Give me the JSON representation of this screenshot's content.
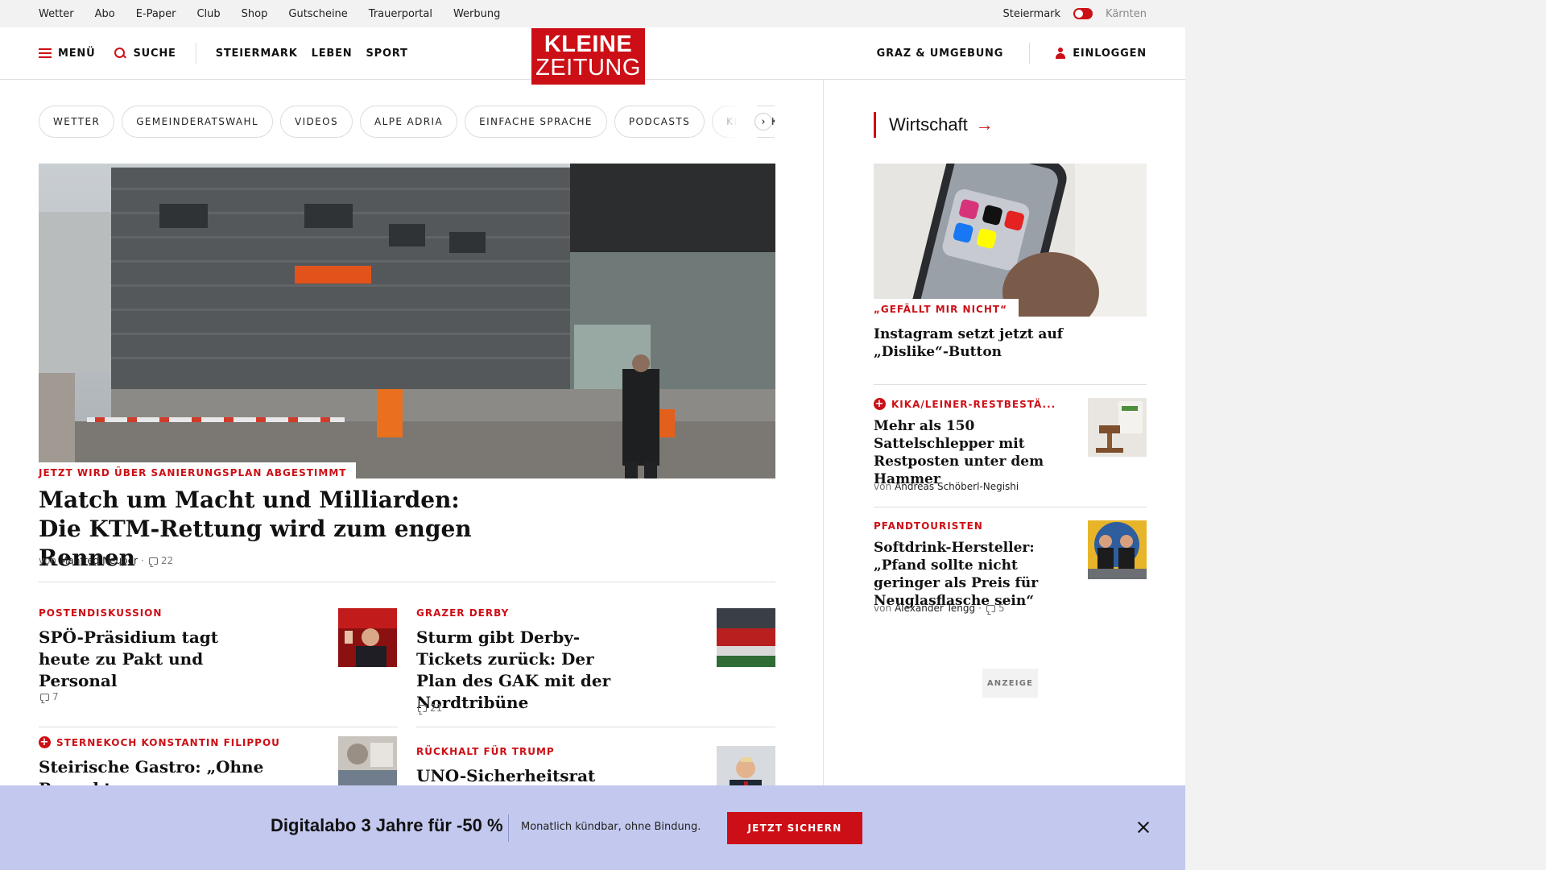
{
  "topbar": {
    "links": [
      "Wetter",
      "Abo",
      "E-Paper",
      "Club",
      "Shop",
      "Gutscheine",
      "Trauerportal",
      "Werbung"
    ],
    "region_active": "Steiermark",
    "region_inactive": "Kärnten"
  },
  "header": {
    "menu_label": "MENÜ",
    "search_label": "SUCHE",
    "nav": [
      "STEIERMARK",
      "LEBEN",
      "SPORT"
    ],
    "logo_line1": "KLEINE",
    "logo_line2": "ZEITUNG",
    "region_link": "GRAZ & UMGEBUNG",
    "login_label": "EINLOGGEN"
  },
  "chips": [
    "WETTER",
    "GEMEINDERATSWAHL",
    "VIDEOS",
    "ALPE ADRIA",
    "EINFACHE SPRACHE",
    "PODCASTS",
    "KLEINE KINDERZEITUNG"
  ],
  "chip_next": "›",
  "hero": {
    "label": "JETZT WIRD ÜBER SANIERUNGSPLAN ABGESTIMMT",
    "title": "Match um Macht und Milliarden: Die KTM-Rettung wird zum engen Rennen",
    "by": "von",
    "author": "Manfred Neuper",
    "sep": "·",
    "comments": "22"
  },
  "articles": [
    {
      "kicker": "POSTENDISKUSSION",
      "title": "SPÖ-Präsidium tagt heute zu Pakt und Personal",
      "comments": "7"
    },
    {
      "kicker": "GRAZER DERBY",
      "title": "Sturm gibt Derby-Tickets zurück: Der Plan des GAK mit der Nordtribüne",
      "comments": "21"
    },
    {
      "kicker": "STERNEKOCH KONSTANTIN FILIPPOU",
      "title": "Steirische Gastro: „Ohne Respekt vor Mitarbeitenden“"
    },
    {
      "kicker": "RÜCKHALT FÜR TRUMP",
      "title": "UNO-Sicherheitsrat stimmt"
    }
  ],
  "sidebar": {
    "section": "Wirtschaft",
    "arrow": "→",
    "top_label": "„GEFÄLLT MIR NICHT“",
    "top_title": "Instagram setzt jetzt auf „Dislike“-Button",
    "items": [
      {
        "kicker": "KIKA/LEINER-RESTBESTÄ...",
        "title": "Mehr als 150 Sattelschlepper mit Restposten unter dem Hammer",
        "by": "von",
        "author": "Andreas Schöberl-Negishi"
      },
      {
        "kicker": "PFANDTOURISTEN",
        "title": "Softdrink-Hersteller: „Pfand sollte nicht geringer als Preis für Neuglasflasche sein“",
        "by": "von",
        "author": "Alexander Tengg",
        "sep": "·",
        "comments": "5"
      }
    ],
    "ad_label": "ANZEIGE"
  },
  "promo": {
    "headline": "Digitalabo 3 Jahre für -50 %",
    "subline": "Monatlich kündbar, ohne Bindung.",
    "button": "JETZT SICHERN"
  },
  "colors": {
    "accent": "#cc0f16",
    "promo_bg": "#c3c8ee"
  }
}
